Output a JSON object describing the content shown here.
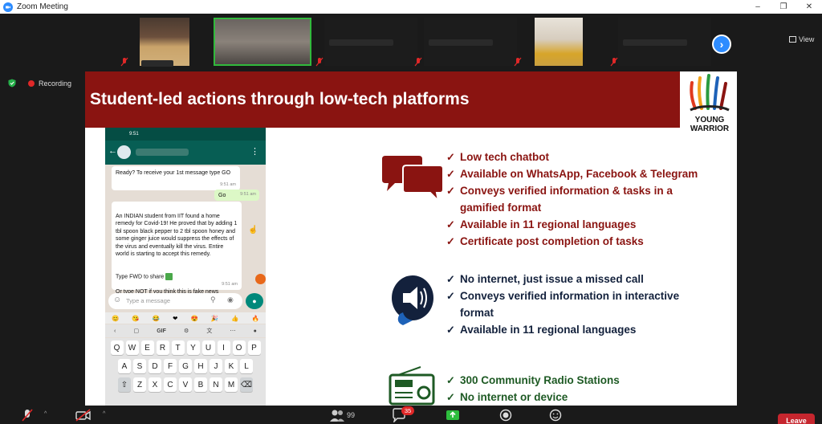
{
  "window": {
    "title": "Zoom Meeting",
    "controls": [
      "–",
      "❐",
      "✕"
    ]
  },
  "gallery": {
    "view_label": "View"
  },
  "recording": {
    "label": "Recording"
  },
  "slide": {
    "title": "Student-led actions through low-tech platforms",
    "logo_line1": "YOUNG",
    "logo_line2": "WARRIOR",
    "group1": [
      "Low tech chatbot",
      "Available on WhatsApp, Facebook & Telegram",
      "Conveys verified information & tasks in a",
      "gamified format",
      "Available in 11 regional languages",
      "Certificate post completion of tasks"
    ],
    "group2": [
      "No internet, just issue a missed call",
      "Conveys verified information in interactive",
      "format",
      "Available in 11 regional languages"
    ],
    "group3": [
      "300 Community Radio Stations",
      "No internet or device"
    ]
  },
  "phone": {
    "status_time": "9:51",
    "msg1": "Ready? To receive your 1st message type GO",
    "msg1_time": "9:51 am",
    "msg2": "Go",
    "msg2_time": "9:51 am",
    "msg3": "An INDIAN student from IIT found a home remedy for Covid-19! He proved that by adding 1 tbl spoon black pepper to 2 tbl spoon honey and some ginger juice would suppress the effects of the virus and eventually kill the virus. Entire world is starting to accept this remedy.",
    "msg3_fwd": "Type FWD to share",
    "msg3_not": "Or type NOT if you think this is fake news",
    "msg3_time": "9:51 am",
    "input_placeholder": "Type a message",
    "gif_label": "GIF",
    "keys_row1": [
      "Q",
      "W",
      "E",
      "R",
      "T",
      "Y",
      "U",
      "I",
      "O",
      "P"
    ],
    "keys_row2": [
      "A",
      "S",
      "D",
      "F",
      "G",
      "H",
      "J",
      "K",
      "L"
    ],
    "keys_row3": [
      "Z",
      "X",
      "C",
      "V",
      "B",
      "N",
      "M"
    ]
  },
  "toolbar": {
    "participants_count": "99",
    "chat_badge": "35",
    "leave_label": "Leave"
  },
  "colors": {
    "banner": "#8a1411",
    "group1": "#8a1411",
    "group2": "#13213c",
    "group3": "#1e5a24",
    "zoom_blue": "#2d8cff",
    "leave_red": "#c6262e"
  }
}
